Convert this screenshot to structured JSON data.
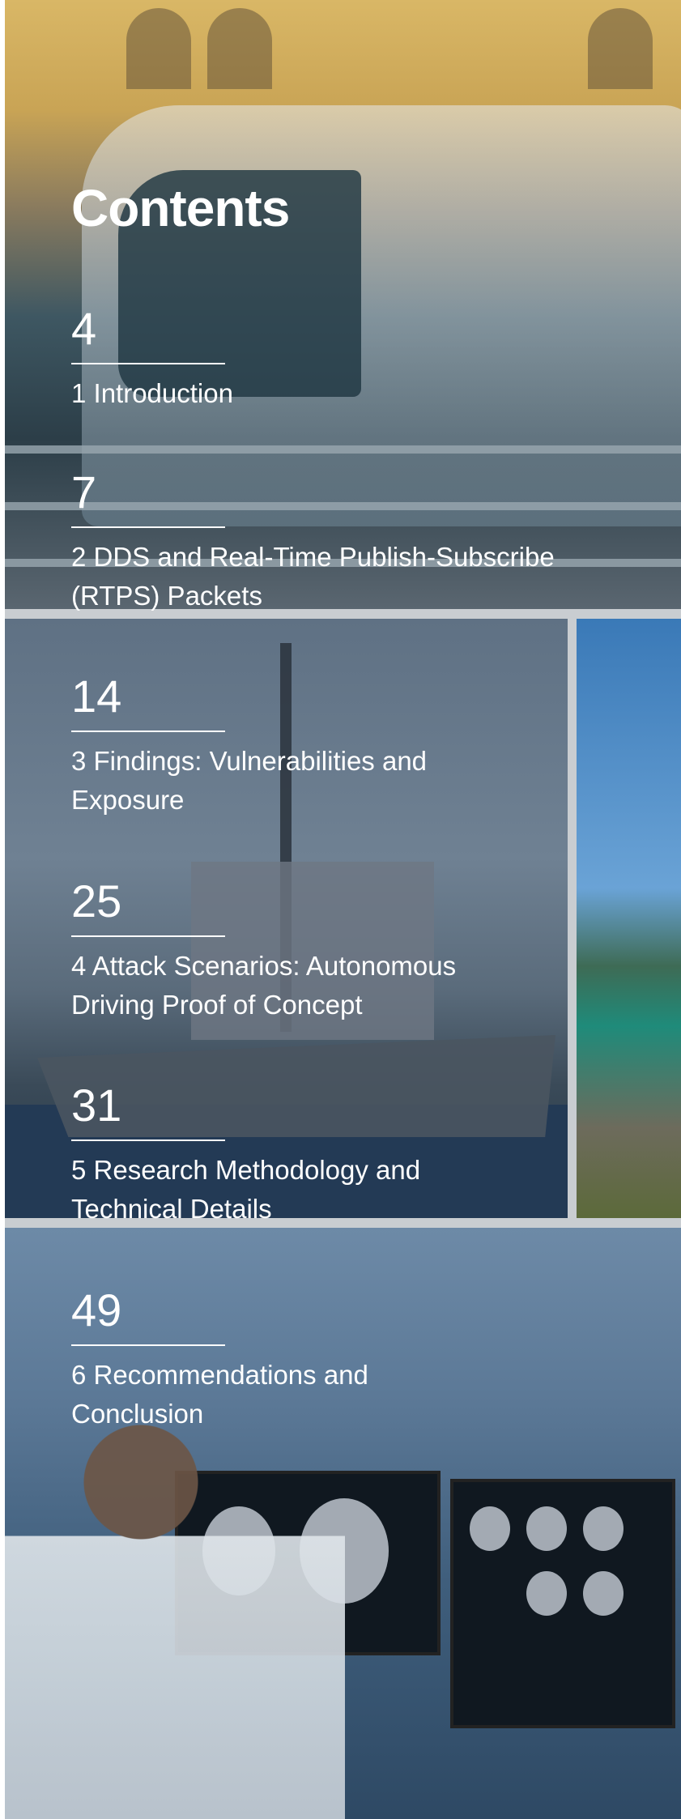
{
  "title": "Contents",
  "entries": [
    {
      "page": "4",
      "label": "1 Introduction"
    },
    {
      "page": "7",
      "label": "2 DDS and Real-Time Publish-Subscribe (RTPS) Packets"
    },
    {
      "page": "14",
      "label": "3 Findings: Vulnerabilities and Exposure"
    },
    {
      "page": "25",
      "label": "4 Attack Scenarios: Autonomous Driving Proof of Concept"
    },
    {
      "page": "31",
      "label": "5 Research Methodology and Technical Details"
    },
    {
      "page": "49",
      "label": "6 Recommendations and Conclusion"
    }
  ]
}
